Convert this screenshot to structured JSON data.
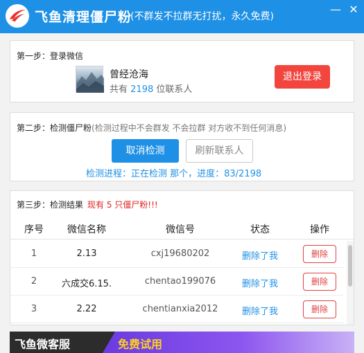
{
  "app": {
    "title": "飞鱼清理僵尸粉",
    "subtitle": "(不群发不拉群无打扰，永久免费)",
    "minimize_glyph": "—",
    "close_glyph": "✕",
    "brand_color": "#1e90e6"
  },
  "step1": {
    "title": "第一步：登录微信",
    "nickname": "曾经沧海",
    "contacts_prefix": "共有",
    "contacts_count": "2198",
    "contacts_suffix": "位联系人",
    "logout_label": "退出登录"
  },
  "step2": {
    "title": "第二步：检测僵尸粉",
    "note": "(检测过程中不会群发 不会拉群 对方收不到任何消息)",
    "cancel_label": "取消检测",
    "refresh_label": "刷新联系人",
    "progress_text": "检测进程：正在检测 那个，进度：83/2198"
  },
  "step3": {
    "title": "第三步：检测结果",
    "result_text": "现有 5 只僵尸粉!!!",
    "columns": [
      "序号",
      "微信名称",
      "微信号",
      "状态",
      "操作"
    ],
    "rows": [
      {
        "no": "1",
        "name": "2.13",
        "wxid": "cxj19680202",
        "status": "删除了我",
        "action": "删除"
      },
      {
        "no": "2",
        "name": "六成交6.15.",
        "wxid": "chentao199076",
        "status": "删除了我",
        "action": "删除"
      },
      {
        "no": "3",
        "name": "2.22",
        "wxid": "chentianxia2012",
        "status": "删除了我",
        "action": "删除"
      }
    ]
  },
  "banner": {
    "name": "飞鱼微客服",
    "promo": "免费试用"
  }
}
